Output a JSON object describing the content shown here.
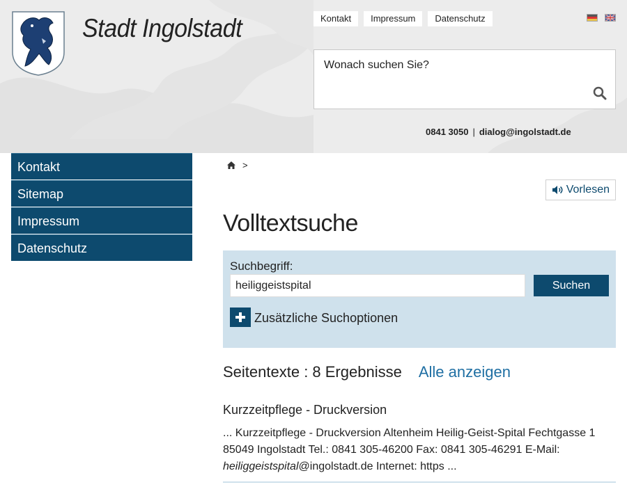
{
  "header": {
    "site_title": "Stadt Ingolstadt",
    "top_links": [
      "Kontakt",
      "Impressum",
      "Datenschutz"
    ],
    "languages": [
      "de",
      "en"
    ],
    "search_placeholder": "Wonach suchen Sie?",
    "phone": "0841 3050",
    "separator": "|",
    "email": "dialog@ingolstadt.de"
  },
  "sidebar": {
    "items": [
      {
        "label": "Kontakt"
      },
      {
        "label": "Sitemap"
      },
      {
        "label": "Impressum"
      },
      {
        "label": "Datenschutz"
      }
    ]
  },
  "main": {
    "breadcrumb_sep": ">",
    "read_aloud_label": "Vorlesen",
    "page_title": "Volltextsuche",
    "search": {
      "label": "Suchbegriff:",
      "value": "heiliggeistspital",
      "submit_label": "Suchen",
      "more_options_label": "Zusätzliche Suchoptionen"
    },
    "results": {
      "heading": "Seitentexte : 8 Ergebnisse",
      "show_all": "Alle anzeigen",
      "first": {
        "title": "Kurzzeitpflege - Druckversion",
        "text_before": "... Kurzzeitpflege - Druckversion Altenheim Heilig-Geist-Spital Fechtgasse 1 85049 Ingolstadt Tel.: 0841 305-46200 Fax: 0841 305-46291 E-Mail: ",
        "highlight": "heiliggeistspital",
        "text_after": "@ingolstadt.de Internet: https ..."
      }
    }
  },
  "colors": {
    "brand_blue": "#0d4a6e",
    "panel_blue": "#cfe1ec",
    "link_blue": "#1f6fa3"
  }
}
